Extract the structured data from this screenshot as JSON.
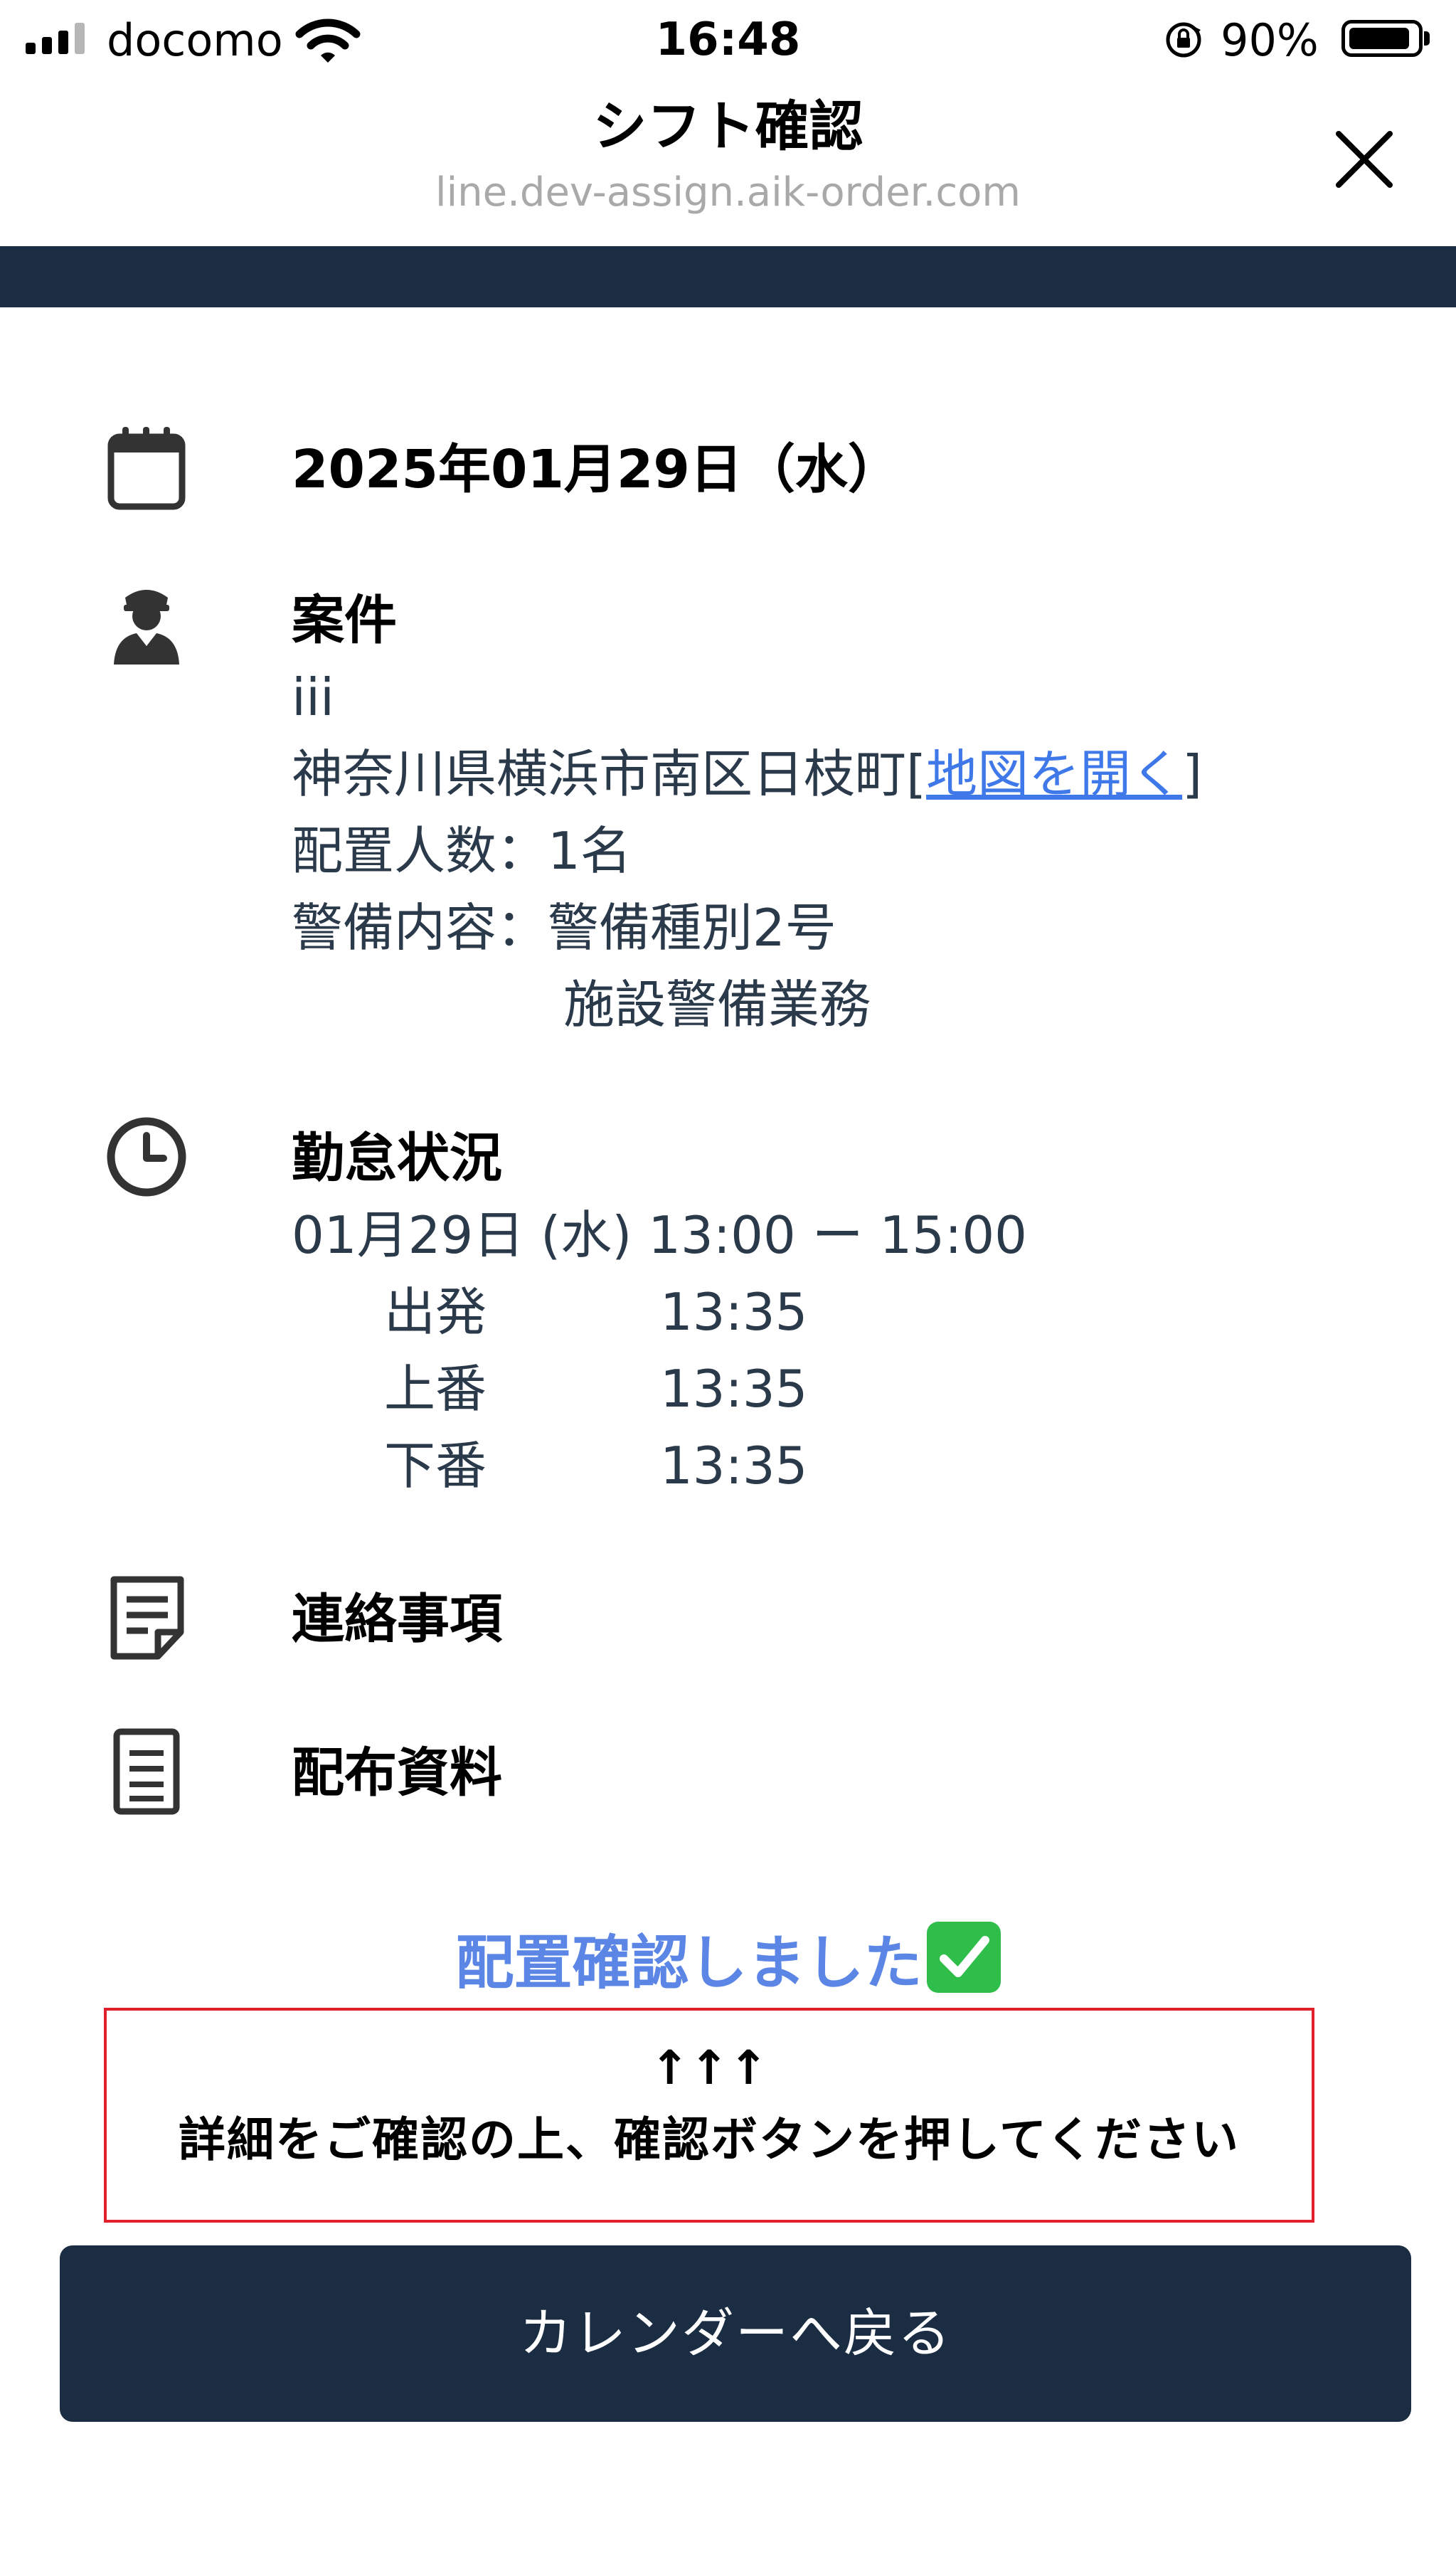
{
  "status_bar": {
    "carrier": "docomo",
    "time": "16:48",
    "battery_percent": "90%",
    "icons": [
      "signal-icon",
      "wifi-icon",
      "orientation-lock-icon",
      "battery-icon"
    ]
  },
  "header": {
    "title": "シフト確認",
    "url": "line.dev-assign.aik-order.com",
    "close_icon": "close-icon"
  },
  "shift": {
    "date": "2025年01月29日（水）",
    "project": {
      "heading": "案件",
      "name": "iii",
      "address": "神奈川県横浜市南区日枝町",
      "map_open": "[",
      "map_link": "地図を開く",
      "map_close": "]",
      "staff_count": "配置人数：1名",
      "guard_content": "警備内容：警備種別2号",
      "guard_content_detail": "施設警備業務"
    },
    "attendance": {
      "heading": "勤怠状況",
      "schedule": "01月29日 (水) 13:00 ー 15:00",
      "records": [
        {
          "label": "出発",
          "time": "13:35"
        },
        {
          "label": "上番",
          "time": "13:35"
        },
        {
          "label": "下番",
          "time": "13:35"
        }
      ]
    },
    "notes_heading": "連絡事項",
    "documents_heading": "配布資料"
  },
  "confirmation": {
    "status": "配置確認しました",
    "arrows": "↑↑↑",
    "instruction": "詳細をご確認の上、確認ボタンを押してください"
  },
  "back_button": "カレンダーへ戻る",
  "colors": {
    "navy": "#1b2d42",
    "link_blue": "#3f79e9",
    "confirm_blue": "#5b86e5",
    "notice_red": "#e0212b",
    "check_green": "#2fbe4a"
  }
}
